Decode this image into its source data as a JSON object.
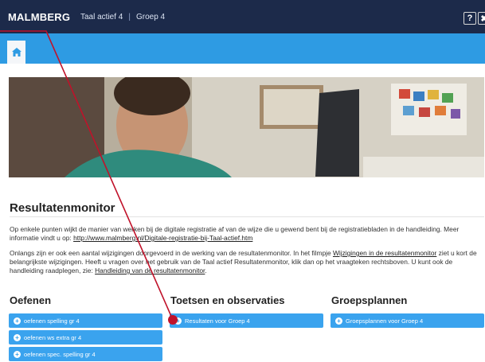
{
  "header": {
    "brand": "MALMBERG",
    "course": "Taal actief 4",
    "separator": "|",
    "group": "Groep 4",
    "help_label": "?",
    "close_label": "✖"
  },
  "nav": {
    "home_icon": "home-icon"
  },
  "main": {
    "title": "Resultatenmonitor",
    "paragraph1": {
      "text": "Op enkele punten wijkt de manier van werken bij de digitale registratie af van de wijze die u gewend bent bij de registratiebladen in de handleiding. Meer informatie vindt u op: ",
      "link": "http://www.malmberg.nl/Digitale-registratie-bij-Taal-actief.htm"
    },
    "paragraph2": {
      "text_before": "Onlangs zijn er ook een aantal wijzigingen doorgevoerd in de werking van de resultatenmonitor. In het filmpje ",
      "link1": "Wijzigingen in de resultatenmonitor",
      "text_middle": " ziet u kort de belangrijkste wijzigingen. Heeft u vragen over het gebruik van de Taal actief Resultatenmonitor, klik dan op het vraagteken rechtsboven. U kunt ook de handleiding raadplegen, zie: ",
      "link2": "Handleiding van de resultatenmonitor",
      "text_after": "."
    }
  },
  "columns": {
    "oefenen": {
      "title": "Oefenen",
      "items": [
        "oefenen spelling gr 4",
        "oefenen ws extra gr 4",
        "oefenen spec. spelling gr 4"
      ]
    },
    "toetsen": {
      "title": "Toetsen en observaties",
      "items": [
        "Resultaten voor Groep 4"
      ]
    },
    "groepsplannen": {
      "title": "Groepsplannen",
      "items": [
        "Groepsplannen voor Groep 4"
      ]
    }
  },
  "colors": {
    "topbar": "#1c2a4a",
    "navband": "#2e9be3",
    "button": "#3aa3ee",
    "annotation": "#c0122a"
  }
}
